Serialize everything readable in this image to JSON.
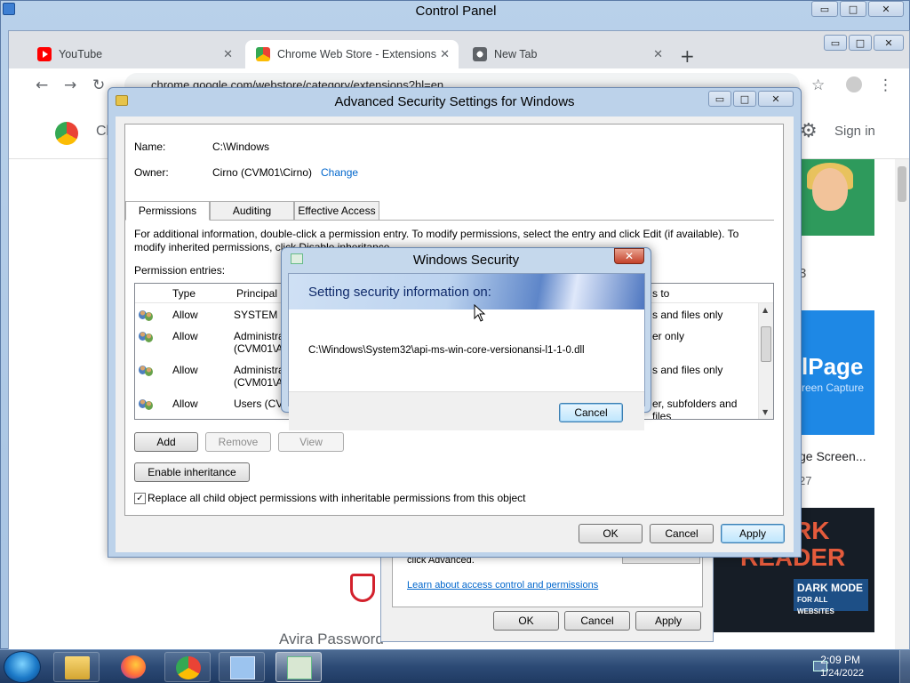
{
  "control_panel": {
    "title": "Control Panel"
  },
  "chrome": {
    "tabs": [
      {
        "label": "YouTube",
        "close": "✕"
      },
      {
        "label": "Chrome Web Store - Extensions",
        "close": "✕"
      },
      {
        "label": "New Tab",
        "close": "✕"
      }
    ],
    "new_tab": "+",
    "url": "chrome.google.com/webstore/category/extensions?hl=en",
    "store_name": "Cl",
    "sign_in": "Sign in",
    "card_rating_partial": "3",
    "fullpage_title": "lPage",
    "fullpage_sub": "reen Capture",
    "card_caption": "ge Screen...",
    "card_count": "27",
    "dark_reader_1": "RK",
    "dark_reader_2": "READER",
    "dark_mode_badge": "DARK MODE",
    "dark_mode_sub": "FOR ALL WEBSITES",
    "avira_text": "Avira Password"
  },
  "properties_dialog": {
    "advanced_text": "click Advanced.",
    "learn_link": "Learn about access control and permissions",
    "ok": "OK",
    "cancel": "Cancel",
    "apply": "Apply"
  },
  "advanced_security": {
    "title": "Advanced Security Settings for Windows",
    "name_label": "Name:",
    "name_value": "C:\\Windows",
    "owner_label": "Owner:",
    "owner_value": "Cirno (CVM01\\Cirno)",
    "change_link": "Change",
    "tabs": [
      "Permissions",
      "Auditing",
      "Effective Access"
    ],
    "info_line1": "For additional information, double-click a permission entry. To modify permissions, select the entry and click Edit (if available). To",
    "info_line2": "modify inherited permissions, click Disable inheritance.",
    "entries_label": "Permission entries:",
    "columns": {
      "type": "Type",
      "principal": "Principal",
      "applies_to": "s to"
    },
    "rows": [
      {
        "type": "Allow",
        "principal": "SYSTEM",
        "principal2": "",
        "applies": "s and files only"
      },
      {
        "type": "Allow",
        "principal": "Administra",
        "principal2": "(CVM01\\A",
        "applies": "er only"
      },
      {
        "type": "Allow",
        "principal": "Administra",
        "principal2": "(CVM01\\A",
        "applies": "s and files only"
      },
      {
        "type": "Allow",
        "principal": "Users (CVI",
        "principal2": "",
        "applies": "er, subfolders and files"
      }
    ],
    "add": "Add",
    "remove": "Remove",
    "view": "View",
    "enable_inheritance": "Enable inheritance",
    "replace_label": "Replace all child object permissions with inheritable permissions from this object",
    "replace_checked": "✓",
    "ok": "OK",
    "cancel": "Cancel",
    "apply": "Apply"
  },
  "windows_security": {
    "title": "Windows Security",
    "heading": "Setting security information on:",
    "path": "C:\\Windows\\System32\\api-ms-win-core-versionansi-l1-1-0.dll",
    "cancel": "Cancel",
    "close": "✕"
  },
  "taskbar": {
    "time": "2:09 PM",
    "date": "1/24/2022"
  },
  "icons": {
    "minimize": "▭",
    "maximize": "□",
    "close": "✕",
    "back": "←",
    "forward": "→",
    "reload": "↻",
    "star": "☆",
    "menu": "⋮",
    "gear": "⚙"
  }
}
